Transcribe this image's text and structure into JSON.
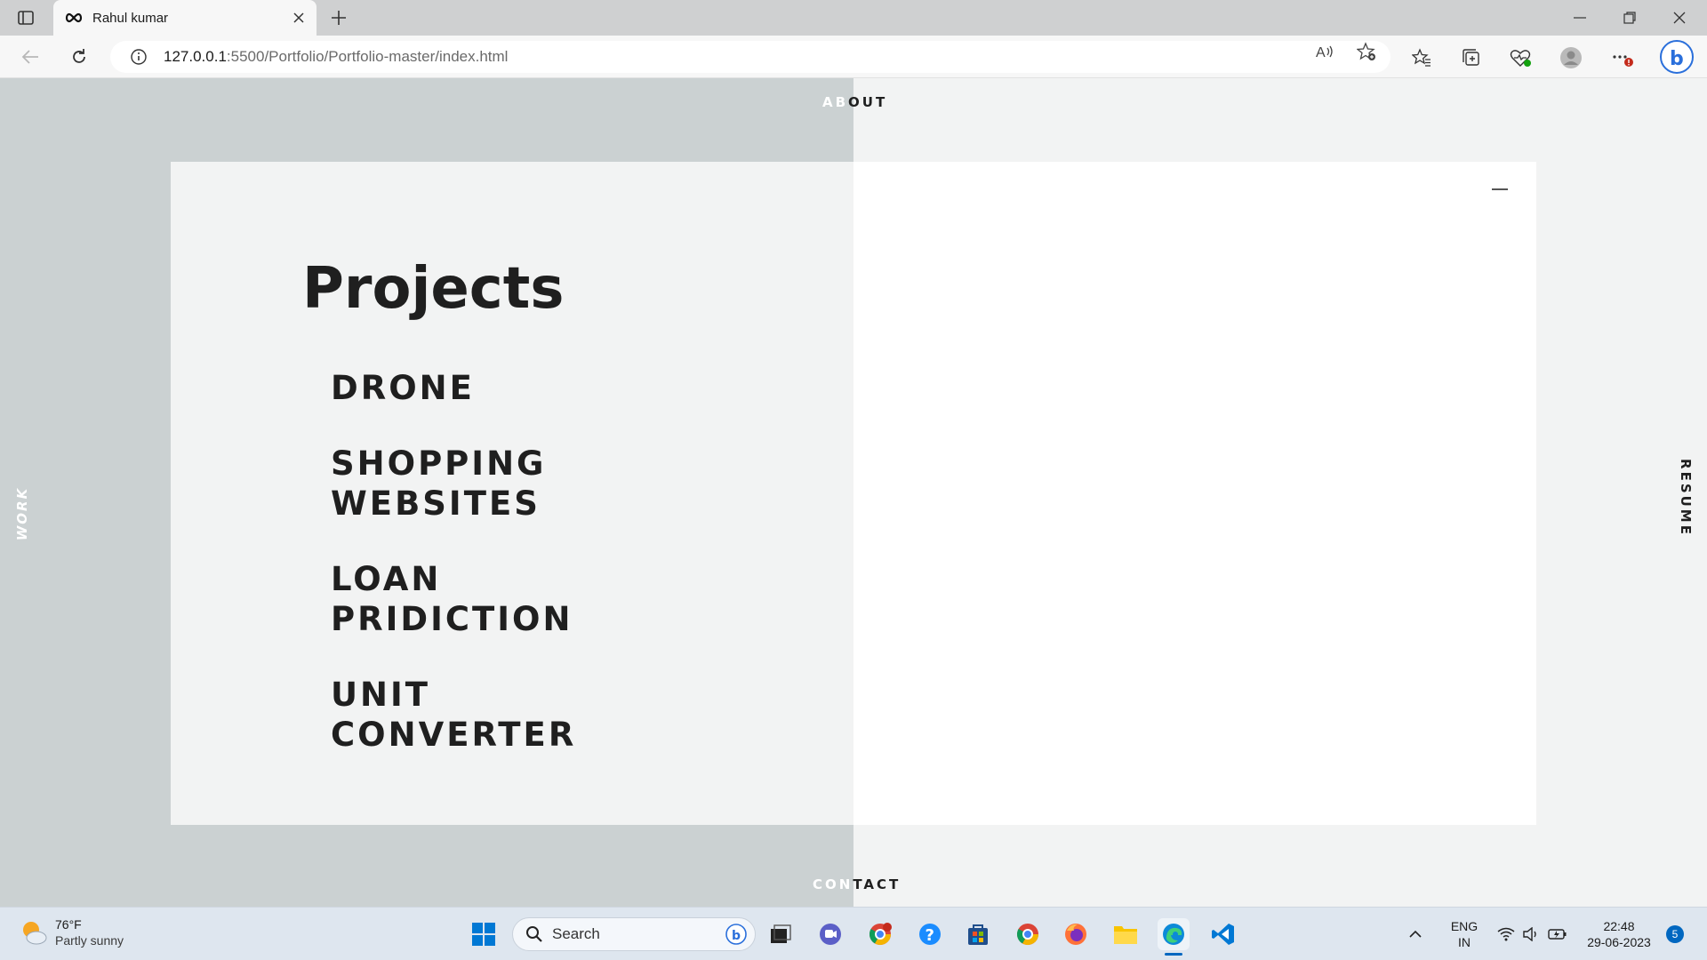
{
  "browser": {
    "tab_title": "Rahul kumar",
    "url_host": "127.0.0.1",
    "url_rest": ":5500/Portfolio/Portfolio-master/index.html"
  },
  "site": {
    "nav_about_light": "AB",
    "nav_about_dark": "OUT",
    "nav_contact_light": "CON",
    "nav_contact_dark": "TACT",
    "nav_work": "WORK",
    "nav_resume": "RESUME",
    "section_title": "Projects",
    "projects": [
      {
        "line1": "DRONE",
        "line2": ""
      },
      {
        "line1": "SHOPPING",
        "line2": "WEBSITES"
      },
      {
        "line1": "LOAN",
        "line2": "PRIDICTION"
      },
      {
        "line1": "UNIT",
        "line2": "CONVERTER"
      }
    ]
  },
  "taskbar": {
    "weather_temp": "76°F",
    "weather_condition": "Partly sunny",
    "search_placeholder": "Search",
    "lang_line1": "ENG",
    "lang_line2": "IN",
    "time": "22:48",
    "date": "29-06-2023",
    "notification_count": "5"
  },
  "colors": {
    "page_bg": "#f2f3f3",
    "left_panel": "#cbd1d2",
    "text_dark": "#1f1f1f",
    "accent": "#0067c0"
  }
}
